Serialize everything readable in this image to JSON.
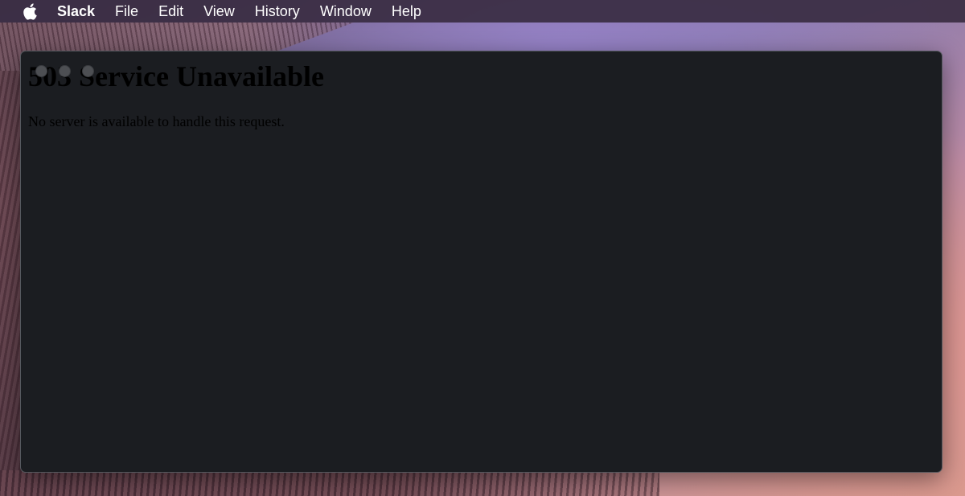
{
  "menubar": {
    "apple_icon": "apple-logo-icon",
    "app_name": "Slack",
    "items": [
      "File",
      "Edit",
      "View",
      "History",
      "Window",
      "Help"
    ]
  },
  "window": {
    "traffic_lights": [
      "close",
      "minimize",
      "zoom"
    ],
    "heading": "503 Service Unavailable",
    "message": "No server is available to handle this request."
  },
  "colors": {
    "window_bg": "#1b1d21",
    "text": "#000000",
    "menubar_text": "#ffffff"
  }
}
